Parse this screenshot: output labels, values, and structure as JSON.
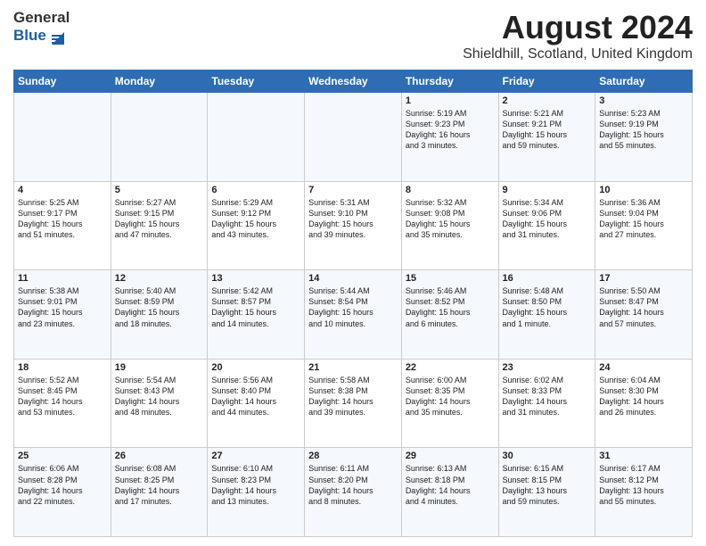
{
  "header": {
    "logo_general": "General",
    "logo_blue": "Blue",
    "month_title": "August 2024",
    "location": "Shieldhill, Scotland, United Kingdom"
  },
  "columns": [
    "Sunday",
    "Monday",
    "Tuesday",
    "Wednesday",
    "Thursday",
    "Friday",
    "Saturday"
  ],
  "weeks": [
    [
      {
        "day": "",
        "info": ""
      },
      {
        "day": "",
        "info": ""
      },
      {
        "day": "",
        "info": ""
      },
      {
        "day": "",
        "info": ""
      },
      {
        "day": "1",
        "info": "Sunrise: 5:19 AM\nSunset: 9:23 PM\nDaylight: 16 hours\nand 3 minutes."
      },
      {
        "day": "2",
        "info": "Sunrise: 5:21 AM\nSunset: 9:21 PM\nDaylight: 15 hours\nand 59 minutes."
      },
      {
        "day": "3",
        "info": "Sunrise: 5:23 AM\nSunset: 9:19 PM\nDaylight: 15 hours\nand 55 minutes."
      }
    ],
    [
      {
        "day": "4",
        "info": "Sunrise: 5:25 AM\nSunset: 9:17 PM\nDaylight: 15 hours\nand 51 minutes."
      },
      {
        "day": "5",
        "info": "Sunrise: 5:27 AM\nSunset: 9:15 PM\nDaylight: 15 hours\nand 47 minutes."
      },
      {
        "day": "6",
        "info": "Sunrise: 5:29 AM\nSunset: 9:12 PM\nDaylight: 15 hours\nand 43 minutes."
      },
      {
        "day": "7",
        "info": "Sunrise: 5:31 AM\nSunset: 9:10 PM\nDaylight: 15 hours\nand 39 minutes."
      },
      {
        "day": "8",
        "info": "Sunrise: 5:32 AM\nSunset: 9:08 PM\nDaylight: 15 hours\nand 35 minutes."
      },
      {
        "day": "9",
        "info": "Sunrise: 5:34 AM\nSunset: 9:06 PM\nDaylight: 15 hours\nand 31 minutes."
      },
      {
        "day": "10",
        "info": "Sunrise: 5:36 AM\nSunset: 9:04 PM\nDaylight: 15 hours\nand 27 minutes."
      }
    ],
    [
      {
        "day": "11",
        "info": "Sunrise: 5:38 AM\nSunset: 9:01 PM\nDaylight: 15 hours\nand 23 minutes."
      },
      {
        "day": "12",
        "info": "Sunrise: 5:40 AM\nSunset: 8:59 PM\nDaylight: 15 hours\nand 18 minutes."
      },
      {
        "day": "13",
        "info": "Sunrise: 5:42 AM\nSunset: 8:57 PM\nDaylight: 15 hours\nand 14 minutes."
      },
      {
        "day": "14",
        "info": "Sunrise: 5:44 AM\nSunset: 8:54 PM\nDaylight: 15 hours\nand 10 minutes."
      },
      {
        "day": "15",
        "info": "Sunrise: 5:46 AM\nSunset: 8:52 PM\nDaylight: 15 hours\nand 6 minutes."
      },
      {
        "day": "16",
        "info": "Sunrise: 5:48 AM\nSunset: 8:50 PM\nDaylight: 15 hours\nand 1 minute."
      },
      {
        "day": "17",
        "info": "Sunrise: 5:50 AM\nSunset: 8:47 PM\nDaylight: 14 hours\nand 57 minutes."
      }
    ],
    [
      {
        "day": "18",
        "info": "Sunrise: 5:52 AM\nSunset: 8:45 PM\nDaylight: 14 hours\nand 53 minutes."
      },
      {
        "day": "19",
        "info": "Sunrise: 5:54 AM\nSunset: 8:43 PM\nDaylight: 14 hours\nand 48 minutes."
      },
      {
        "day": "20",
        "info": "Sunrise: 5:56 AM\nSunset: 8:40 PM\nDaylight: 14 hours\nand 44 minutes."
      },
      {
        "day": "21",
        "info": "Sunrise: 5:58 AM\nSunset: 8:38 PM\nDaylight: 14 hours\nand 39 minutes."
      },
      {
        "day": "22",
        "info": "Sunrise: 6:00 AM\nSunset: 8:35 PM\nDaylight: 14 hours\nand 35 minutes."
      },
      {
        "day": "23",
        "info": "Sunrise: 6:02 AM\nSunset: 8:33 PM\nDaylight: 14 hours\nand 31 minutes."
      },
      {
        "day": "24",
        "info": "Sunrise: 6:04 AM\nSunset: 8:30 PM\nDaylight: 14 hours\nand 26 minutes."
      }
    ],
    [
      {
        "day": "25",
        "info": "Sunrise: 6:06 AM\nSunset: 8:28 PM\nDaylight: 14 hours\nand 22 minutes."
      },
      {
        "day": "26",
        "info": "Sunrise: 6:08 AM\nSunset: 8:25 PM\nDaylight: 14 hours\nand 17 minutes."
      },
      {
        "day": "27",
        "info": "Sunrise: 6:10 AM\nSunset: 8:23 PM\nDaylight: 14 hours\nand 13 minutes."
      },
      {
        "day": "28",
        "info": "Sunrise: 6:11 AM\nSunset: 8:20 PM\nDaylight: 14 hours\nand 8 minutes."
      },
      {
        "day": "29",
        "info": "Sunrise: 6:13 AM\nSunset: 8:18 PM\nDaylight: 14 hours\nand 4 minutes."
      },
      {
        "day": "30",
        "info": "Sunrise: 6:15 AM\nSunset: 8:15 PM\nDaylight: 13 hours\nand 59 minutes."
      },
      {
        "day": "31",
        "info": "Sunrise: 6:17 AM\nSunset: 8:12 PM\nDaylight: 13 hours\nand 55 minutes."
      }
    ]
  ]
}
